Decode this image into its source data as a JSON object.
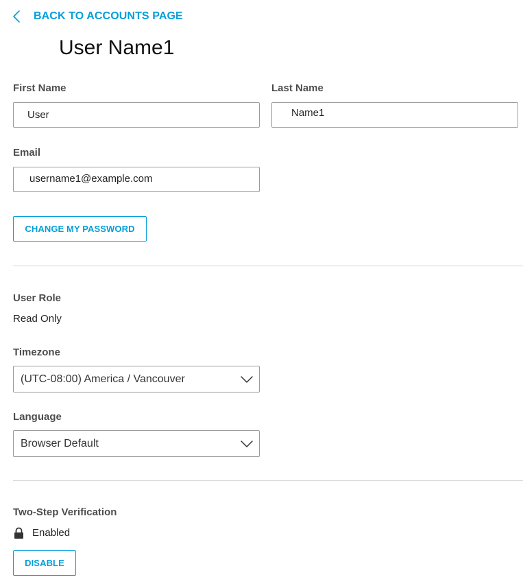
{
  "nav": {
    "back_label": "BACK TO ACCOUNTS PAGE"
  },
  "page": {
    "title": "User Name1"
  },
  "form": {
    "first_name": {
      "label": "First Name",
      "value": "User"
    },
    "last_name": {
      "label": "Last Name",
      "value": "Name1"
    },
    "email": {
      "label": "Email",
      "value": "username1@example.com"
    },
    "change_password_label": "CHANGE MY PASSWORD"
  },
  "settings": {
    "user_role": {
      "label": "User Role",
      "value": "Read Only"
    },
    "timezone": {
      "label": "Timezone",
      "selected": "(UTC-08:00) America / Vancouver"
    },
    "language": {
      "label": "Language",
      "selected": "Browser Default"
    }
  },
  "two_step": {
    "label": "Two-Step Verification",
    "status": "Enabled",
    "disable_label": "DISABLE"
  },
  "colors": {
    "accent": "#049fd9",
    "border": "#9a9a9a",
    "divider": "#d6d6d6"
  },
  "icons": {
    "back": "chevron-left-icon",
    "dropdown": "chevron-down-icon",
    "status": "lock-icon"
  }
}
